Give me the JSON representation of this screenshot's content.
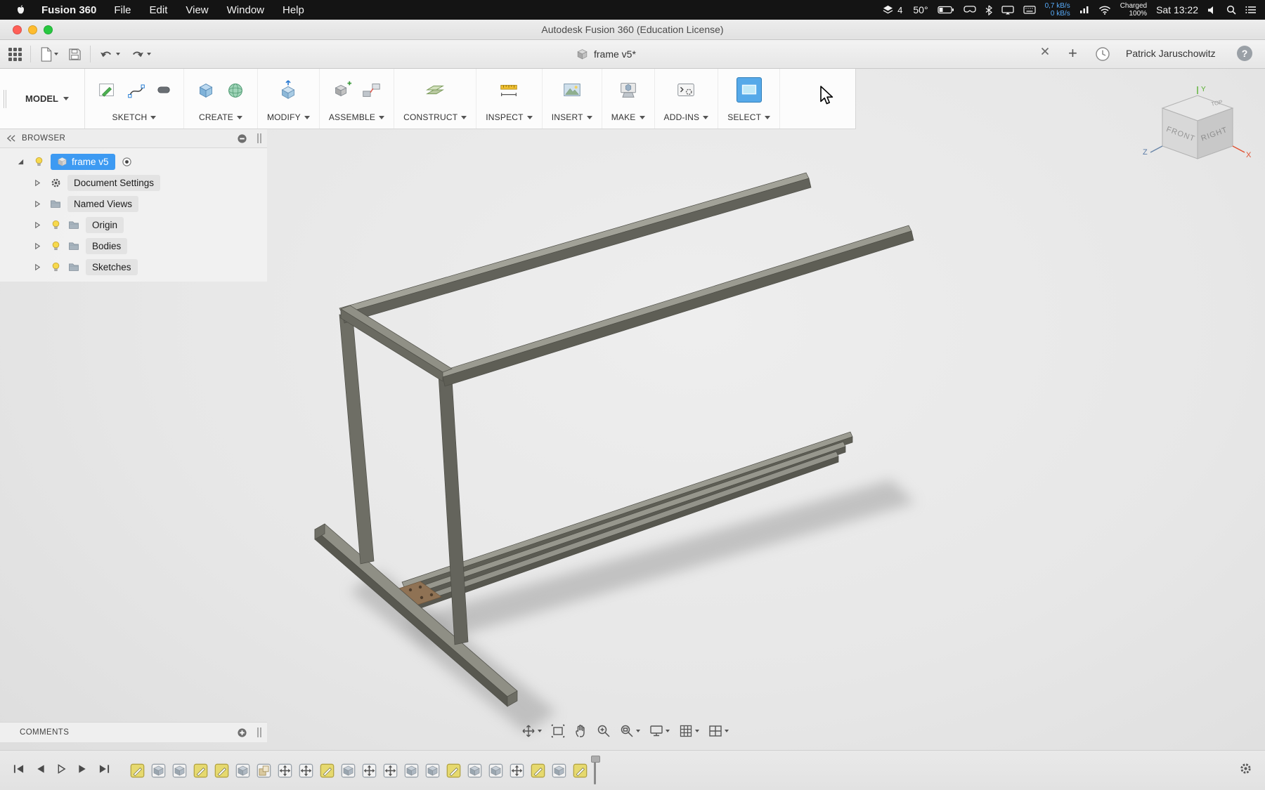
{
  "colors": {
    "selection_blue": "#3d9af2",
    "select_button_blue": "#56a9e9",
    "net_text_blue": "#57aaf8",
    "traffic_red": "#ff5f57",
    "traffic_yellow": "#febc2e",
    "traffic_green": "#28c840",
    "beam_top": "#9b9b91",
    "beam_side": "#5e5e55"
  },
  "menubar": {
    "app_name": "Fusion 360",
    "menus": [
      "File",
      "Edit",
      "View",
      "Window",
      "Help"
    ],
    "status": {
      "layers_badge": "4",
      "temperature": "50°",
      "net_up": "0,7 kB/s",
      "net_down": "0 kB/s",
      "charge_state": "Charged",
      "charge_percent": "100%",
      "clock": "Sat 13:22"
    }
  },
  "titlebar": {
    "title": "Autodesk Fusion 360 (Education License)"
  },
  "toolbar": {
    "tab_label": "frame v5*",
    "add_tab_label": "+",
    "user_name": "Patrick Jaruschowitz",
    "help_label": "?"
  },
  "ribbon": {
    "workspace_label": "MODEL",
    "groups": [
      {
        "label": "SKETCH"
      },
      {
        "label": "CREATE"
      },
      {
        "label": "MODIFY"
      },
      {
        "label": "ASSEMBLE"
      },
      {
        "label": "CONSTRUCT"
      },
      {
        "label": "INSPECT"
      },
      {
        "label": "INSERT"
      },
      {
        "label": "MAKE"
      },
      {
        "label": "ADD-INS"
      },
      {
        "label": "SELECT"
      }
    ]
  },
  "browser": {
    "title": "BROWSER",
    "root_label": "frame v5",
    "items": [
      {
        "label": "Document Settings"
      },
      {
        "label": "Named Views"
      },
      {
        "label": "Origin"
      },
      {
        "label": "Bodies"
      },
      {
        "label": "Sketches"
      }
    ]
  },
  "viewcube": {
    "front": "FRONT",
    "right": "RIGHT",
    "top": "TOP",
    "axis_x": "X",
    "axis_y": "Y",
    "axis_z": "Z"
  },
  "comments": {
    "title": "COMMENTS"
  },
  "timeline": {
    "features": [
      "sketch",
      "feature",
      "feature",
      "sketch",
      "sketch",
      "feature",
      "component",
      "move",
      "move",
      "sketch",
      "feature",
      "move",
      "move",
      "feature",
      "feature",
      "sketch",
      "feature",
      "feature",
      "move",
      "sketch",
      "feature",
      "sketch"
    ]
  }
}
